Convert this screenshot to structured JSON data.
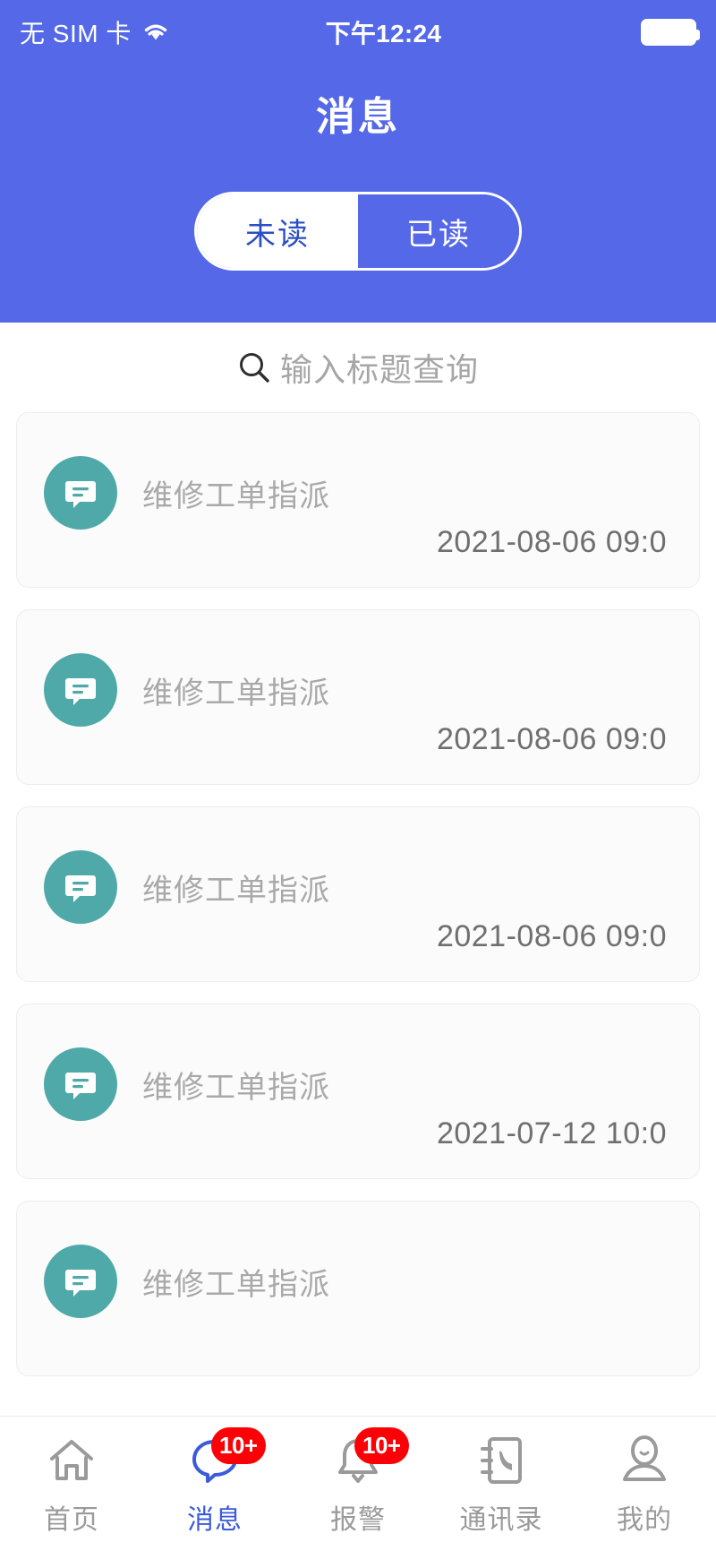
{
  "status_bar": {
    "carrier": "无 SIM 卡",
    "wifi_icon": "wifi-icon",
    "time": "下午12:24",
    "battery_icon": "battery-full-icon"
  },
  "header": {
    "title": "消息",
    "accent_color": "#5468e8",
    "tabs": [
      {
        "label": "未读",
        "active": true
      },
      {
        "label": "已读",
        "active": false
      }
    ]
  },
  "search": {
    "icon": "search-icon",
    "placeholder": "输入标题查询",
    "value": ""
  },
  "messages": [
    {
      "icon": "message-bubble-icon",
      "title": "维修工单指派",
      "time": "2021-08-06 09:0"
    },
    {
      "icon": "message-bubble-icon",
      "title": "维修工单指派",
      "time": "2021-08-06 09:0"
    },
    {
      "icon": "message-bubble-icon",
      "title": "维修工单指派",
      "time": "2021-08-06 09:0"
    },
    {
      "icon": "message-bubble-icon",
      "title": "维修工单指派",
      "time": "2021-07-12 10:0"
    },
    {
      "icon": "message-bubble-icon",
      "title": "维修工单指派",
      "time": ""
    }
  ],
  "avatar_color": "#4fa9a8",
  "tabbar": {
    "items": [
      {
        "label": "首页",
        "icon": "home-icon",
        "badge": "",
        "active": false
      },
      {
        "label": "消息",
        "icon": "chat-icon",
        "badge": "10+",
        "active": true
      },
      {
        "label": "报警",
        "icon": "bell-icon",
        "badge": "10+",
        "active": false
      },
      {
        "label": "通讯录",
        "icon": "contacts-icon",
        "badge": "",
        "active": false
      },
      {
        "label": "我的",
        "icon": "person-icon",
        "badge": "",
        "active": false
      }
    ],
    "badge_color": "#fb0007",
    "active_color": "#3b5bdb"
  }
}
